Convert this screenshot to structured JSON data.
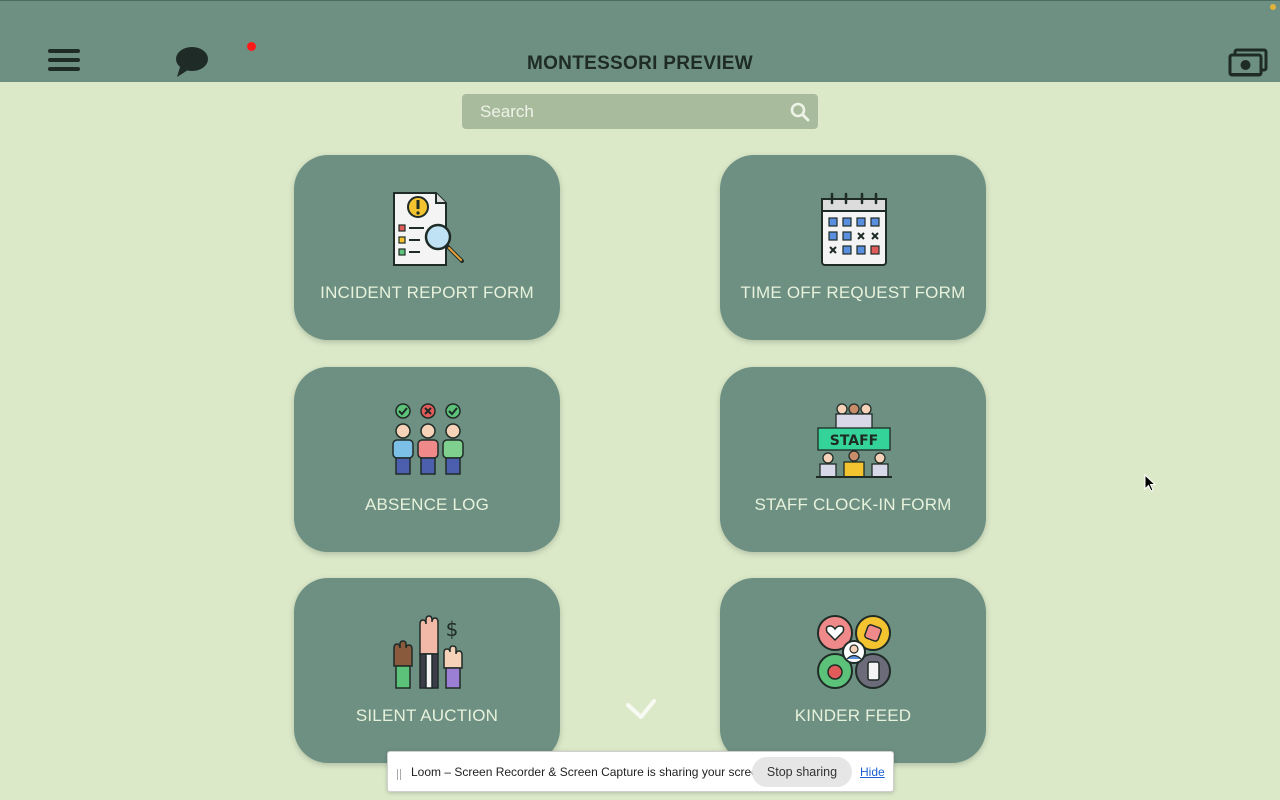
{
  "app": {
    "title": "MONTESSORI PREVIEW",
    "accent_color": "#6e9082",
    "background_color": "#dbe9c9",
    "notification_color": "#ff1a1a"
  },
  "header": {
    "menu_icon": "hamburger-menu-icon",
    "chat_icon": "chat-bubble-icon",
    "right_icon": "money-stack-icon"
  },
  "search": {
    "placeholder": "Search",
    "value": "",
    "icon": "search-icon"
  },
  "cards": [
    {
      "label": "INCIDENT REPORT FORM",
      "icon": "incident-report-icon"
    },
    {
      "label": "TIME OFF REQUEST FORM",
      "icon": "calendar-icon"
    },
    {
      "label": "ABSENCE LOG",
      "icon": "attendance-people-icon"
    },
    {
      "label": "STAFF CLOCK-IN FORM",
      "icon": "staff-group-icon"
    },
    {
      "label": "SILENT AUCTION",
      "icon": "raised-hands-bid-icon"
    },
    {
      "label": "KINDER FEED",
      "icon": "social-feed-icon"
    }
  ],
  "screen_share": {
    "message": "Loom – Screen Recorder & Screen Capture is sharing your screen.",
    "stop_label": "Stop sharing",
    "hide_label": "Hide"
  }
}
